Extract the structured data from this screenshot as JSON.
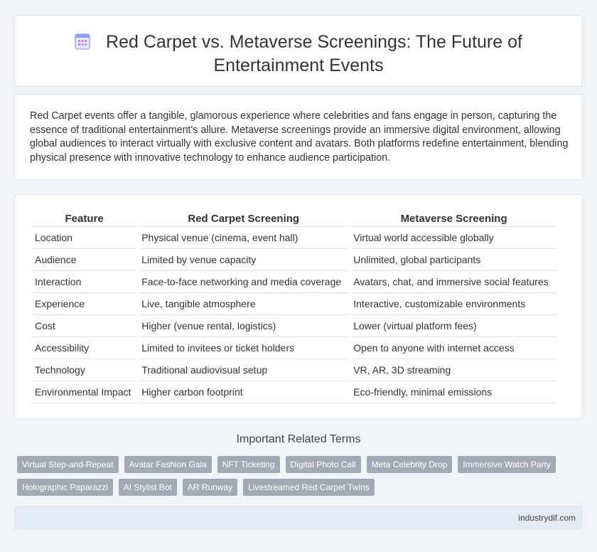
{
  "header": {
    "title": "Red Carpet vs. Metaverse Screenings: The Future of Entertainment Events",
    "icon": "document-icon"
  },
  "intro": {
    "text": "Red Carpet events offer a tangible, glamorous experience where celebrities and fans engage in person, capturing the essence of traditional entertainment's allure. Metaverse screenings provide an immersive digital environment, allowing global audiences to interact virtually with exclusive content and avatars. Both platforms redefine entertainment, blending physical presence with innovative technology to enhance audience participation."
  },
  "table": {
    "headers": [
      "Feature",
      "Red Carpet Screening",
      "Metaverse Screening"
    ],
    "rows": [
      [
        "Location",
        "Physical venue (cinema, event hall)",
        "Virtual world accessible globally"
      ],
      [
        "Audience",
        "Limited by venue capacity",
        "Unlimited, global participants"
      ],
      [
        "Interaction",
        "Face-to-face networking and media coverage",
        "Avatars, chat, and immersive social features"
      ],
      [
        "Experience",
        "Live, tangible atmosphere",
        "Interactive, customizable environments"
      ],
      [
        "Cost",
        "Higher (venue rental, logistics)",
        "Lower (virtual platform fees)"
      ],
      [
        "Accessibility",
        "Limited to invitees or ticket holders",
        "Open to anyone with internet access"
      ],
      [
        "Technology",
        "Traditional audiovisual setup",
        "VR, AR, 3D streaming"
      ],
      [
        "Environmental Impact",
        "Higher carbon footprint",
        "Eco-friendly, minimal emissions"
      ]
    ]
  },
  "related": {
    "title": "Important Related Terms",
    "tags": [
      "Virtual Step-and-Repeat",
      "Avatar Fashion Gala",
      "NFT Ticketing",
      "Digital Photo Call",
      "Meta Celebrity Drop",
      "Immersive Watch Party",
      "Holographic Paparazzi",
      "AI Stylist Bot",
      "AR Runway",
      "Livestreamed Red Carpet Twins"
    ]
  },
  "footer": {
    "source": "industrydif.com"
  },
  "colors": {
    "background": "#f1f4f9",
    "tag": "#a2aab7",
    "footer": "#e5ebf5",
    "icon": "#8c9df0"
  }
}
